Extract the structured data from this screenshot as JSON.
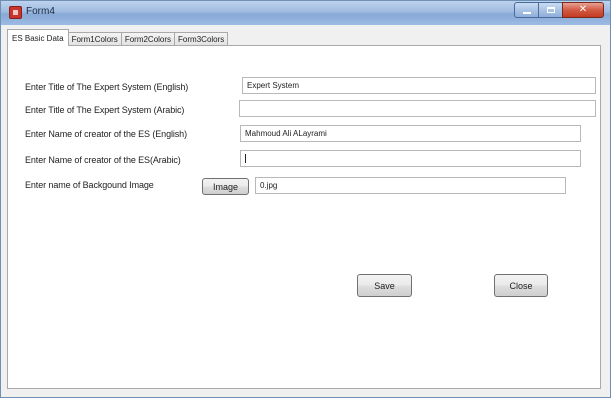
{
  "window": {
    "title": "Form4"
  },
  "tabs": [
    {
      "label": "ES Basic Data",
      "active": true
    },
    {
      "label": "Form1Colors",
      "active": false
    },
    {
      "label": "Form2Colors",
      "active": false
    },
    {
      "label": "Form3Colors",
      "active": false
    }
  ],
  "form": {
    "title_english": {
      "label": "Enter Title of The Expert System (English)",
      "value": "Expert System"
    },
    "title_arabic": {
      "label": "Enter Title of The Expert System (Arabic)",
      "value": ""
    },
    "creator_english": {
      "label": "Enter Name of creator of the ES (English)",
      "value": "Mahmoud Ali ALayrami"
    },
    "creator_arabic": {
      "label": "Enter Name of creator of the ES(Arabic)",
      "value": ""
    },
    "background_image": {
      "label": "Enter name of Backgound Image",
      "button_label": "Image",
      "value": "0.jpg"
    }
  },
  "actions": {
    "save_label": "Save",
    "close_label": "Close"
  },
  "colors": {
    "titlebar": "#9fbbe0",
    "close_button": "#c23b22",
    "window_background": "#f0f0f0",
    "tab_page_background": "#ffffff"
  },
  "icons": {
    "app": "form-app-icon",
    "minimize": "minimize-icon",
    "maximize": "maximize-icon",
    "close": "close-icon"
  }
}
